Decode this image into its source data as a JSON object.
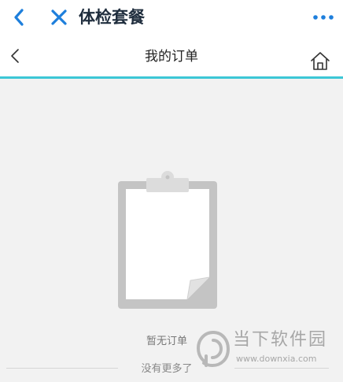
{
  "topbar": {
    "title": "体检套餐",
    "accent": "#1e7fdc",
    "back_icon": "chevron-left-icon",
    "close_icon": "close-icon",
    "more_icon": "more-dots-icon"
  },
  "navbar": {
    "title": "我的订单",
    "underline_color": "#3cc7d6",
    "back_icon": "chevron-left-icon",
    "home_icon": "home-icon"
  },
  "empty_state": {
    "icon": "clipboard-icon",
    "message": "暂无订单",
    "no_more": "没有更多了"
  },
  "watermark": {
    "name": "当下软件园",
    "url": "www.downxia.com"
  }
}
